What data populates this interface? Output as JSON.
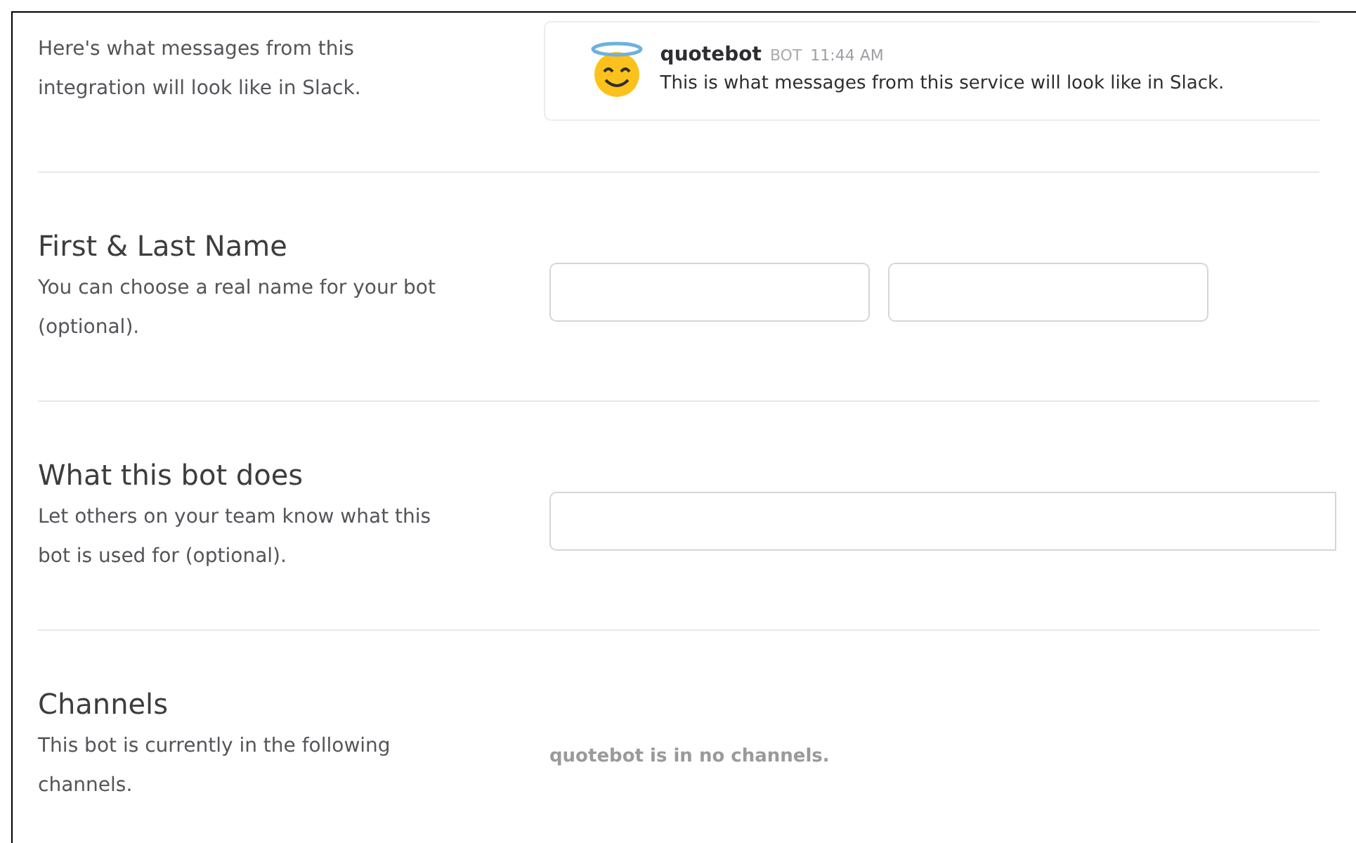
{
  "preview": {
    "description": "Here's what messages from this integration will look like in Slack.",
    "message": {
      "username": "quotebot",
      "badge": "BOT",
      "time": "11:44 AM",
      "text": "This is what messages from this service will look like in Slack."
    }
  },
  "sections": [
    {
      "kind": "name",
      "heading": "First & Last Name",
      "description": "You can choose a real name for your bot (optional)."
    },
    {
      "kind": "purpose",
      "heading": "What this bot does",
      "description": "Let others on your team know what this bot is used for (optional)."
    },
    {
      "kind": "channels",
      "heading": "Channels",
      "description": "This bot is currently in the following channels.",
      "note": "quotebot is in no channels."
    }
  ]
}
